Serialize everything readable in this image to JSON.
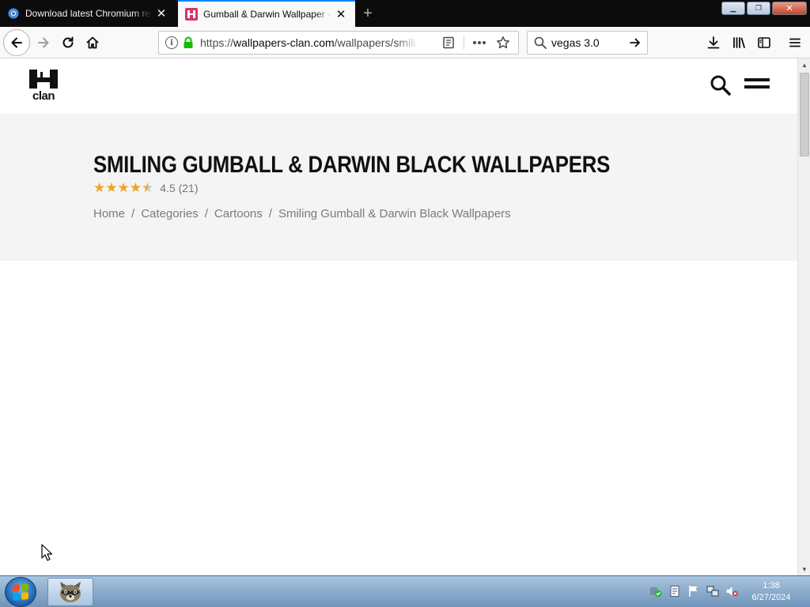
{
  "browser": {
    "tabs": [
      {
        "title": "Download latest Chromium rel",
        "active": false,
        "favicon": "chromium-icon"
      },
      {
        "title": "Gumball & Darwin Wallpaper - ",
        "active": true,
        "favicon": "wallpapers-clan-icon"
      }
    ],
    "url": {
      "host": "wallpapers-clan.com",
      "scheme": "https://",
      "path": "/wallpapers/smili"
    },
    "search_value": "vegas 3.0"
  },
  "site": {
    "logo_text": "clan",
    "title": "SMILING GUMBALL & DARWIN BLACK WALLPAPERS",
    "rating": {
      "score": "4.5",
      "count": "(21)",
      "stars": 4.5
    },
    "breadcrumbs": [
      "Home",
      "Categories",
      "Cartoons",
      "Smiling Gumball & Darwin Black Wallpapers"
    ]
  },
  "taskbar": {
    "time": "1:38",
    "date": "6/27/2024"
  },
  "colors": {
    "accent_tab": "#0a84ff",
    "star": "#f4a21b",
    "hero_bg": "#f4f4f4"
  }
}
